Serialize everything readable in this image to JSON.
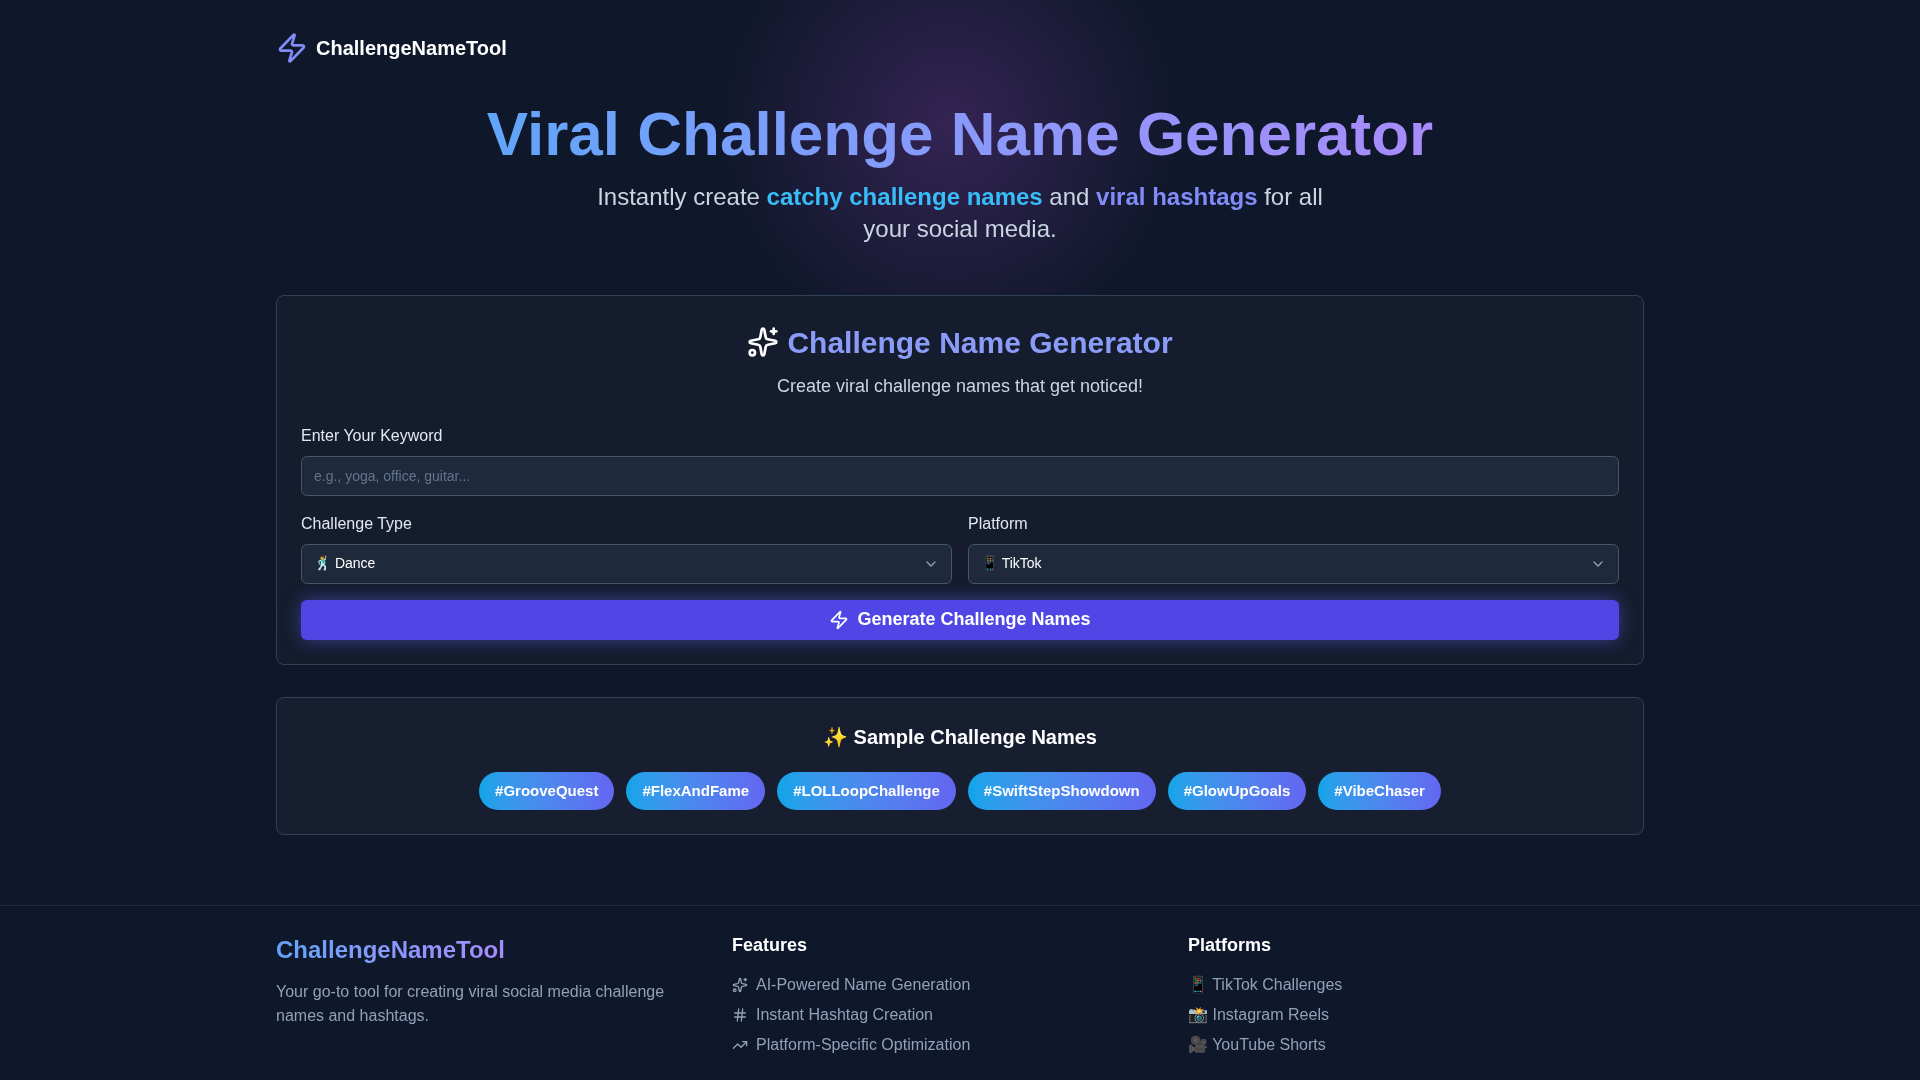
{
  "nav": {
    "brand": "ChallengeNameTool"
  },
  "hero": {
    "title": "Viral Challenge Name Generator",
    "subtitle": "Instantly create **catchy challenge names** and **viral hashtags** for all your social media."
  },
  "generator": {
    "title": "Challenge Name Generator",
    "subtitle": "Create viral challenge names that get noticed!",
    "keyword": {
      "label": "Enter Your Keyword",
      "placeholder": "e.g., yoga, office, guitar..."
    },
    "challenge_type": {
      "label": "Challenge Type",
      "value": "🕺 Dance"
    },
    "platform": {
      "label": "Platform",
      "value": "📱 TikTok"
    },
    "button": "Generate Challenge Names"
  },
  "samples": {
    "title": "✨ Sample Challenge Names",
    "tags": [
      "#GrooveQuest",
      "#FlexAndFame",
      "#LOLLoopChallenge",
      "#SwiftStepShowdown",
      "#GlowUpGoals",
      "#VibeChaser"
    ]
  },
  "footer": {
    "brand": "ChallengeNameTool",
    "description": "Your go-to tool for creating viral social media challenge names and hashtags.",
    "features": {
      "title": "Features",
      "items": [
        "AI-Powered Name Generation",
        "Instant Hashtag Creation",
        "Platform-Specific Optimization"
      ]
    },
    "platforms": {
      "title": "Platforms",
      "items": [
        "📱 TikTok Challenges",
        "📸 Instagram Reels",
        "🎥 YouTube Shorts"
      ]
    }
  }
}
